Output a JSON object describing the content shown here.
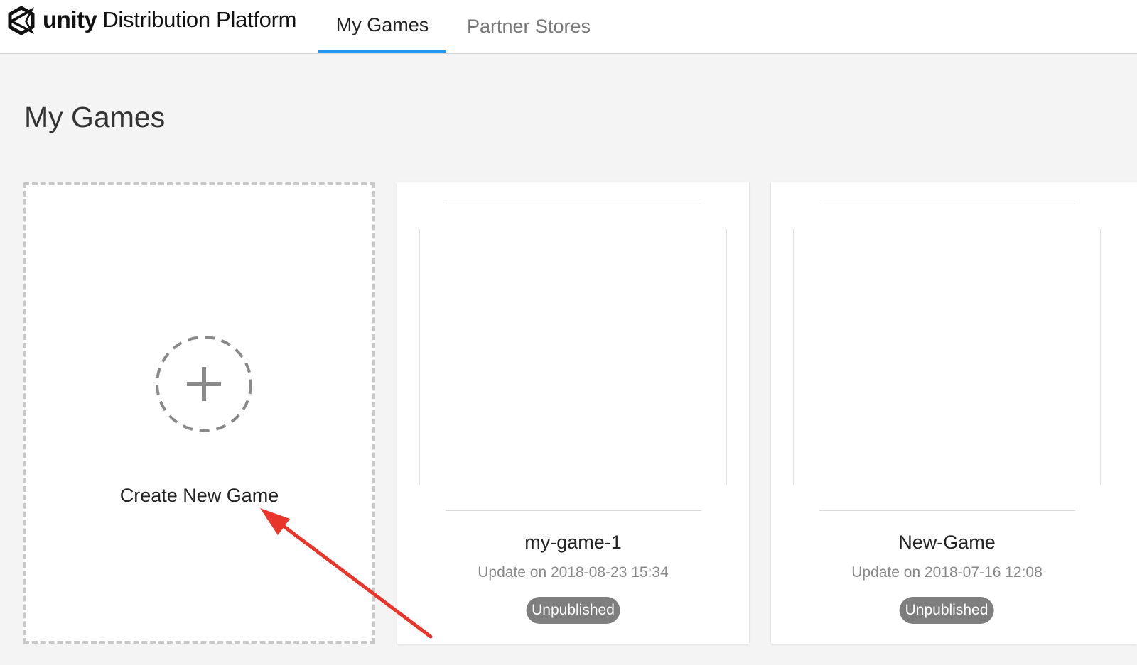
{
  "header": {
    "logo_word": "unity",
    "logo_product": "Distribution Platform",
    "tabs": [
      {
        "label": "My Games",
        "active": true
      },
      {
        "label": "Partner Stores",
        "active": false
      }
    ]
  },
  "main": {
    "title": "My Games",
    "create_card": {
      "label": "Create New Game",
      "icon": "plus-icon"
    },
    "games": [
      {
        "name": "my-game-1",
        "updated": "Update on 2018-08-23 15:34",
        "status": "Unpublished"
      },
      {
        "name": "New-Game",
        "updated": "Update on 2018-07-16 12:08",
        "status": "Unpublished"
      }
    ]
  },
  "colors": {
    "accent": "#2196f3",
    "badge": "#7e7e7e",
    "annotation_arrow": "#e8362b"
  }
}
